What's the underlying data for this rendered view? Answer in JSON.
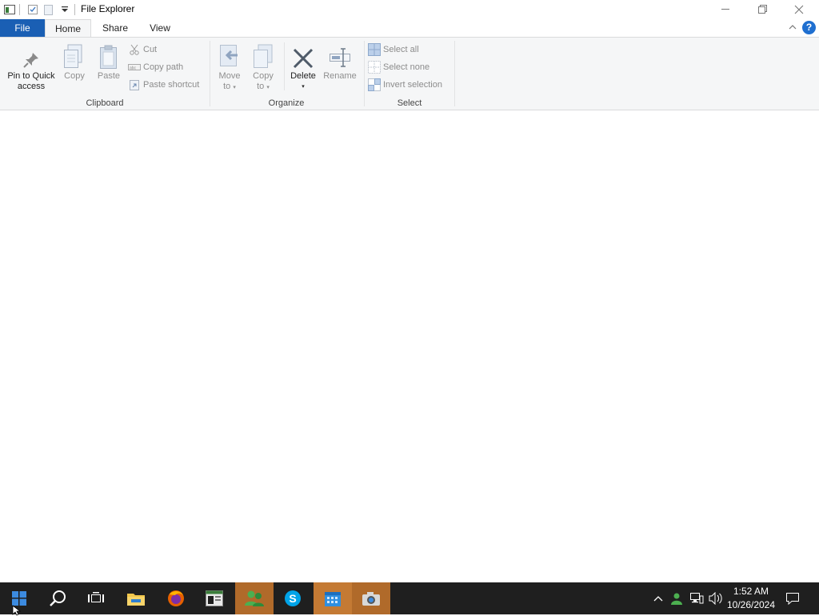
{
  "window": {
    "title": "File Explorer",
    "tabs": [
      {
        "label": "File"
      },
      {
        "label": "Home"
      },
      {
        "label": "Share"
      },
      {
        "label": "View"
      }
    ]
  },
  "ribbon": {
    "clipboard": {
      "label": "Clipboard",
      "pin_line1": "Pin to Quick",
      "pin_line2": "access",
      "copy": "Copy",
      "paste": "Paste",
      "cut": "Cut",
      "copy_path": "Copy path",
      "paste_shortcut": "Paste shortcut"
    },
    "organize": {
      "label": "Organize",
      "move_line1": "Move",
      "move_line2": "to",
      "copyto_line1": "Copy",
      "copyto_line2": "to",
      "delete": "Delete",
      "rename": "Rename"
    },
    "select": {
      "label": "Select",
      "select_all": "Select all",
      "select_none": "Select none",
      "invert": "Invert selection"
    }
  },
  "taskbar": {
    "time": "1:52 AM",
    "date": "10/26/2024"
  },
  "colors": {
    "file_tab": "#1a5fb4",
    "taskbar": "#1f1f1f",
    "ribbon": "#f5f6f7",
    "active_app": "#b06a2a"
  }
}
